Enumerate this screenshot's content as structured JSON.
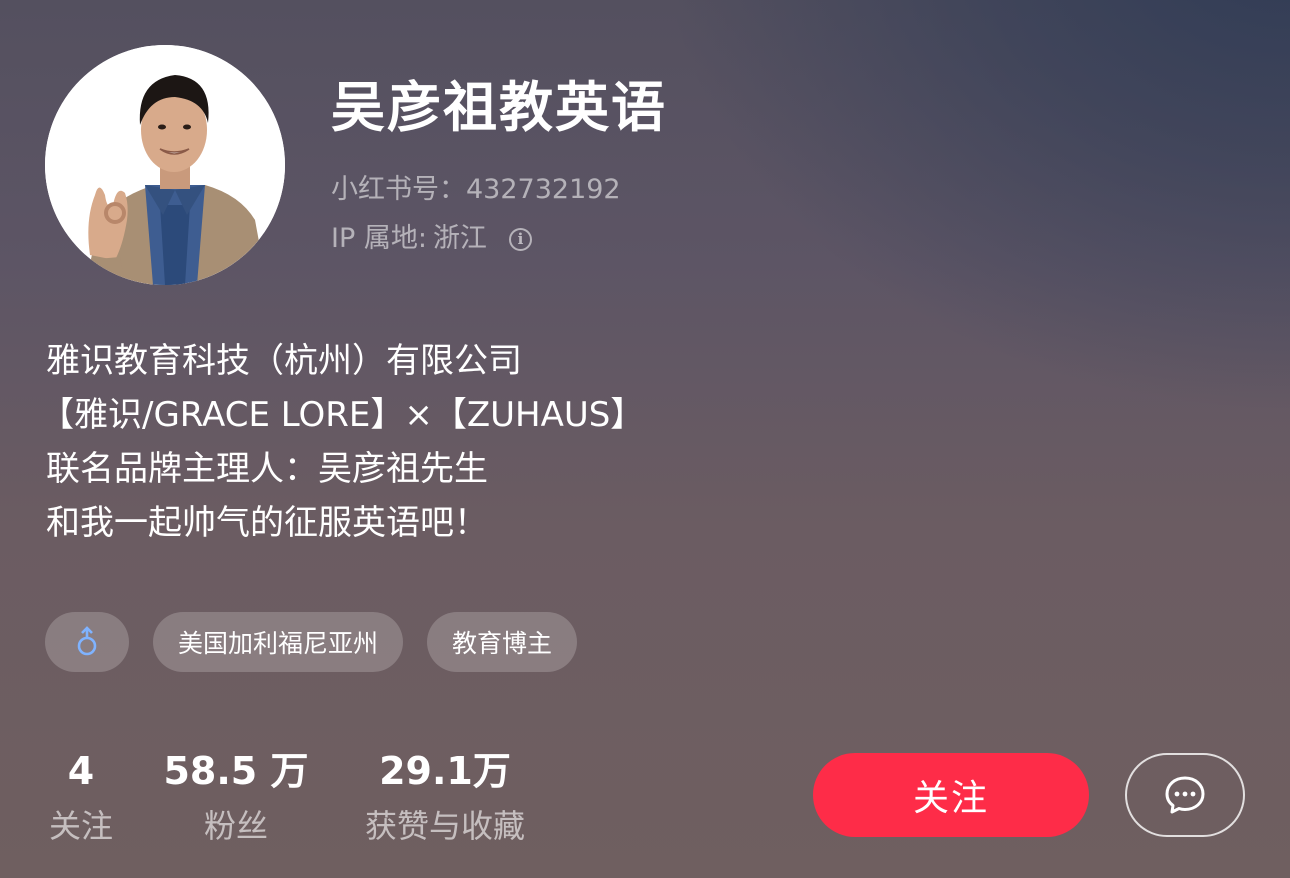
{
  "profile": {
    "nickname": "吴彦祖教英语",
    "id_line": "小红书号：432732192",
    "ip_label": "IP 属地:",
    "ip_value": "浙江",
    "info_icon": "info-icon",
    "avatar_icon": "avatar-photo"
  },
  "bio": {
    "lines": [
      "雅识教育科技（杭州）有限公司",
      "【雅识/GRACE LORE】×【ZUHAUS】",
      "联名品牌主理人：吴彦祖先生",
      "和我一起帅气的征服英语吧！"
    ]
  },
  "tags": {
    "gender_icon": "male-icon",
    "gender_color": "#7fb3ff",
    "location": "美国加利福尼亚州",
    "category": "教育博主"
  },
  "stats": {
    "following": {
      "value": "4",
      "label": "关注"
    },
    "fans": {
      "value": "58.5",
      "unit": "万",
      "label": "粉丝"
    },
    "likes": {
      "value": "29.1",
      "unit": "万",
      "label": "获赞与收藏"
    }
  },
  "actions": {
    "follow_label": "关注",
    "follow_color": "#fe2c48",
    "chat_icon": "chat-bubble-icon"
  }
}
